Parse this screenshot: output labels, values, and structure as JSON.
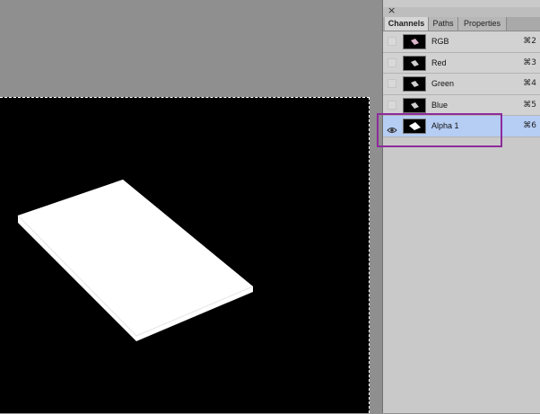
{
  "panel": {
    "close_label": "×",
    "tabs": [
      {
        "label": "Channels",
        "active": true
      },
      {
        "label": "Paths",
        "active": false
      },
      {
        "label": "Properties",
        "active": false
      }
    ],
    "channels": [
      {
        "label": "RGB",
        "shortcut": "⌘2",
        "visible": false,
        "selected": false
      },
      {
        "label": "Red",
        "shortcut": "⌘3",
        "visible": false,
        "selected": false
      },
      {
        "label": "Green",
        "shortcut": "⌘4",
        "visible": false,
        "selected": false
      },
      {
        "label": "Blue",
        "shortcut": "⌘5",
        "visible": false,
        "selected": false
      },
      {
        "label": "Alpha 1",
        "shortcut": "⌘6",
        "visible": true,
        "selected": true
      }
    ]
  },
  "colors": {
    "selection": "#b6cdf4",
    "highlight_outline": "#8e2a9c"
  }
}
